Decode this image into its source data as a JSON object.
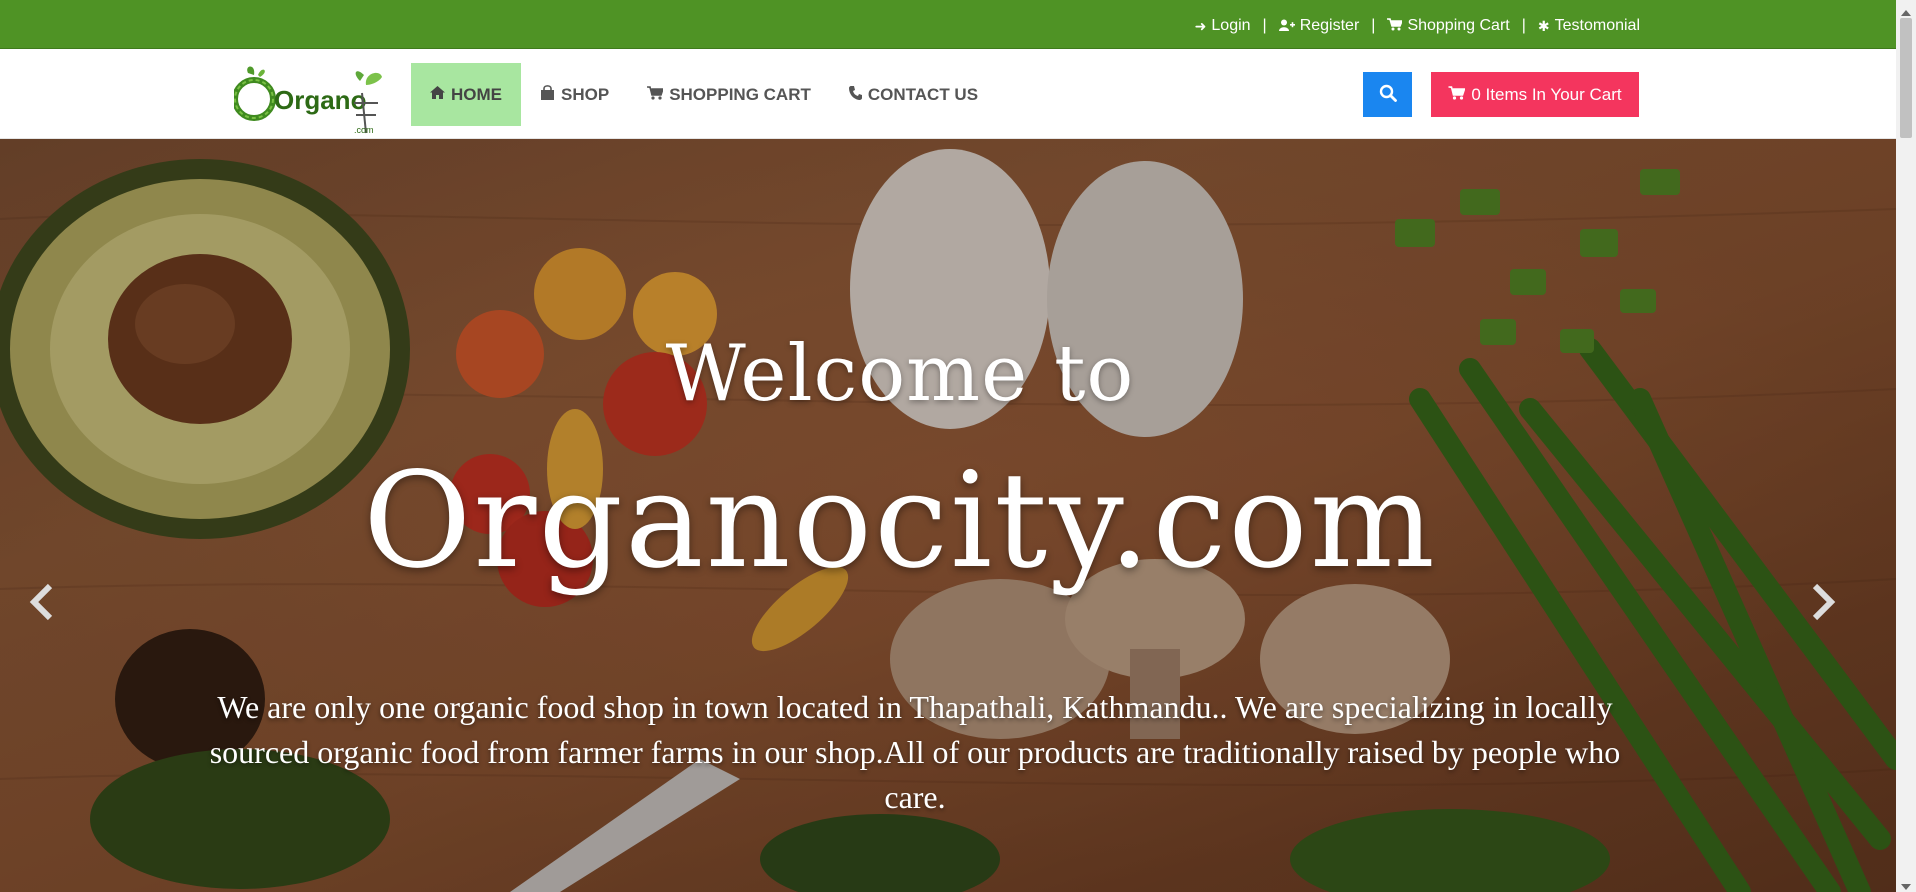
{
  "topbar": {
    "links": [
      {
        "label": "Login",
        "icon": "sign-in-icon"
      },
      {
        "label": "Register",
        "icon": "user-plus-icon"
      },
      {
        "label": "Shopping Cart",
        "icon": "cart-icon"
      },
      {
        "label": "Testomonial",
        "icon": "asterisk-icon"
      }
    ],
    "separator": "|"
  },
  "header": {
    "logo_text": "Organo",
    "logo_small": ".com",
    "nav": [
      {
        "label": "HOME",
        "icon": "home-icon"
      },
      {
        "label": "SHOP",
        "icon": "shopping-bag-icon"
      },
      {
        "label": "SHOPPING CART",
        "icon": "cart-icon"
      },
      {
        "label": "CONTACT US",
        "icon": "phone-icon"
      }
    ],
    "cart_button": "0 Items In Your Cart"
  },
  "hero": {
    "subtitle": "Welcome to",
    "title": "Organocity.com",
    "description": "We are  only one organic food shop in town located in Thapathali, Kathmandu.. We are specializing in locally sourced organic food from farmer farms in our shop.All of  our products are traditionally raised by people who care."
  },
  "colors": {
    "topbar": "#4f9325",
    "nav_active": "#a8e6a0",
    "search": "#1a86f0",
    "cart": "#f4355e"
  }
}
